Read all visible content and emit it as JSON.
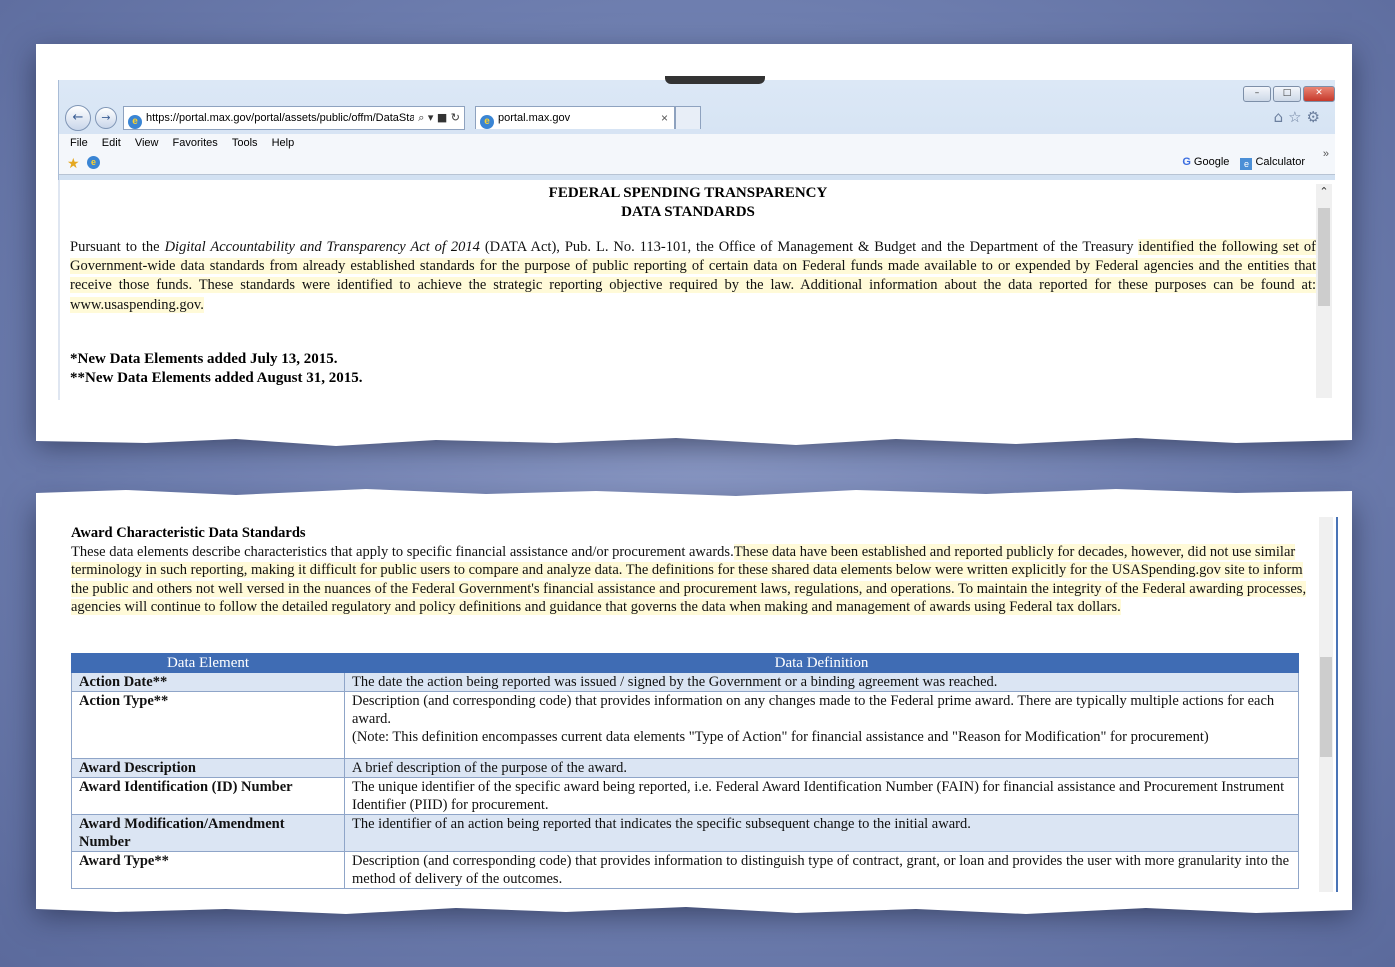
{
  "browser": {
    "address": "https://portal.max.gov/portal/assets/public/offm/DataSta",
    "address_tools": "⌕ ▾ ■ ↻",
    "tab_title": "portal.max.gov",
    "tab_close": "×",
    "menu": [
      "File",
      "Edit",
      "View",
      "Favorites",
      "Tools",
      "Help"
    ],
    "favorites": {
      "google_label": "Google",
      "calculator_label": "Calculator",
      "more": "»"
    },
    "window_buttons": {
      "minimize": "–",
      "maximize": "□",
      "close": "✕"
    },
    "icons": [
      "home-icon",
      "star-icon",
      "gear-icon"
    ]
  },
  "document": {
    "title_line1": "FEDERAL SPENDING TRANSPARENCY",
    "title_line2": "DATA STANDARDS",
    "intro_a": "Pursuant to the ",
    "intro_italic": "Digital Accountability and Transparency Act of 2014",
    "intro_b": " (DATA Act), Pub. L. No. 113-101, the Office of Management & Budget and the Department of the Treasury ",
    "intro_highlight": "identified the following set of Government-wide data standards from already established standards for the purpose of public reporting of certain data on Federal funds made available to or expended by Federal agencies and the entities that receive those funds.  These standards were identified to achieve the strategic reporting objective required by the law. Additional information about the data reported for these purposes can be found at: www.usaspending.gov.",
    "new_elements_1": "*New Data Elements added July 13, 2015.",
    "new_elements_2": "**New Data Elements added August 31, 2015."
  },
  "award_section": {
    "title": "Award Characteristic Data Standards",
    "para_a": "These data elements describe characteristics that apply to specific financial assistance and/or procurement awards.",
    "para_highlight": "These data have been established and reported publicly for decades, however, did not use similar terminology in such reporting, making it difficult for public users to compare and analyze data.  The definitions for these shared data elements below were written explicitly for the USASpending.gov site to inform the public and others not well versed in the nuances of the Federal Government's financial assistance and procurement laws, regulations, and operations.    To maintain the integrity of the Federal awarding processes, agencies will continue to follow the detailed regulatory and policy definitions and guidance that governs the data when making and management of awards using Federal tax dollars.",
    "table": {
      "headers": [
        "Data Element",
        "Data Definition"
      ],
      "rows": [
        {
          "element": "Action Date**",
          "definition": "The date the action being reported was issued / signed by the Government or a binding agreement was reached.",
          "note": ""
        },
        {
          "element": "Action Type**",
          "definition": "Description (and corresponding code) that provides information on any changes made to the Federal prime award. There are typically multiple actions for each award.",
          "note": "(Note: This definition encompasses current data elements \"Type of Action\" for financial assistance and \"Reason for Modification\" for procurement)"
        },
        {
          "element": "Award Description",
          "definition": "A brief description of the purpose of the award.",
          "note": ""
        },
        {
          "element": "Award Identification (ID) Number",
          "definition": "The unique identifier of the specific award being reported, i.e. Federal Award Identification Number (FAIN) for financial assistance and Procurement Instrument Identifier (PIID) for procurement.",
          "note": ""
        },
        {
          "element": "Award Modification/Amendment Number",
          "definition": "The identifier of an action being reported that indicates the specific subsequent change to the initial award.",
          "note": ""
        },
        {
          "element": "Award Type**",
          "definition": "Description (and corresponding code) that provides information to distinguish type of contract, grant, or loan and provides the user with more granularity into the method of delivery of the outcomes.",
          "note": ""
        }
      ]
    }
  },
  "colors": {
    "background": "#7383b4",
    "table_header": "#3f6cb4",
    "highlight": "#fffad8",
    "row_alt": "#dbe5f3"
  }
}
